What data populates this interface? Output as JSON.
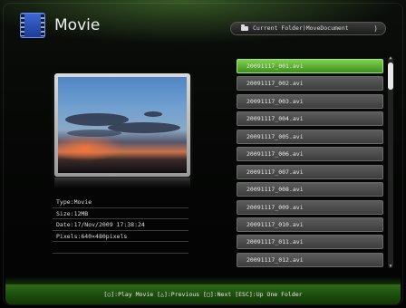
{
  "header": {
    "title": "Movie",
    "app_icon": "film-icon",
    "folder_path": "Current Folder)MoveDocument",
    "folder_icon": "folder-icon",
    "folder_chevron": ")"
  },
  "preview": {
    "description_icon": "video-thumbnail"
  },
  "info": {
    "type": "Type:Movie",
    "size": "Size:12MB",
    "date": "Date:17/Nov/2009 17:38:24",
    "pixels": "Pixels:640×480pixels"
  },
  "file_list": {
    "items": [
      "20091117_001.avi",
      "20091117_002.avi",
      "20091117_003.avi",
      "20091117_004.avi",
      "20091117_005.avi",
      "20091117_006.avi",
      "20091117_007.avi",
      "20091117_008.avi",
      "20091117_009.avi",
      "20091117_010.avi",
      "20091117_011.avi",
      "20091117_012.avi"
    ],
    "selected_index": 0
  },
  "footer": {
    "hint": "[○]:Play Movie  [△]:Previous  [□]:Next  [ESC]:Up One Folder"
  },
  "colors": {
    "accent": "#5fb534",
    "footer": "#1e4c10",
    "item": "#4a4a4a"
  }
}
